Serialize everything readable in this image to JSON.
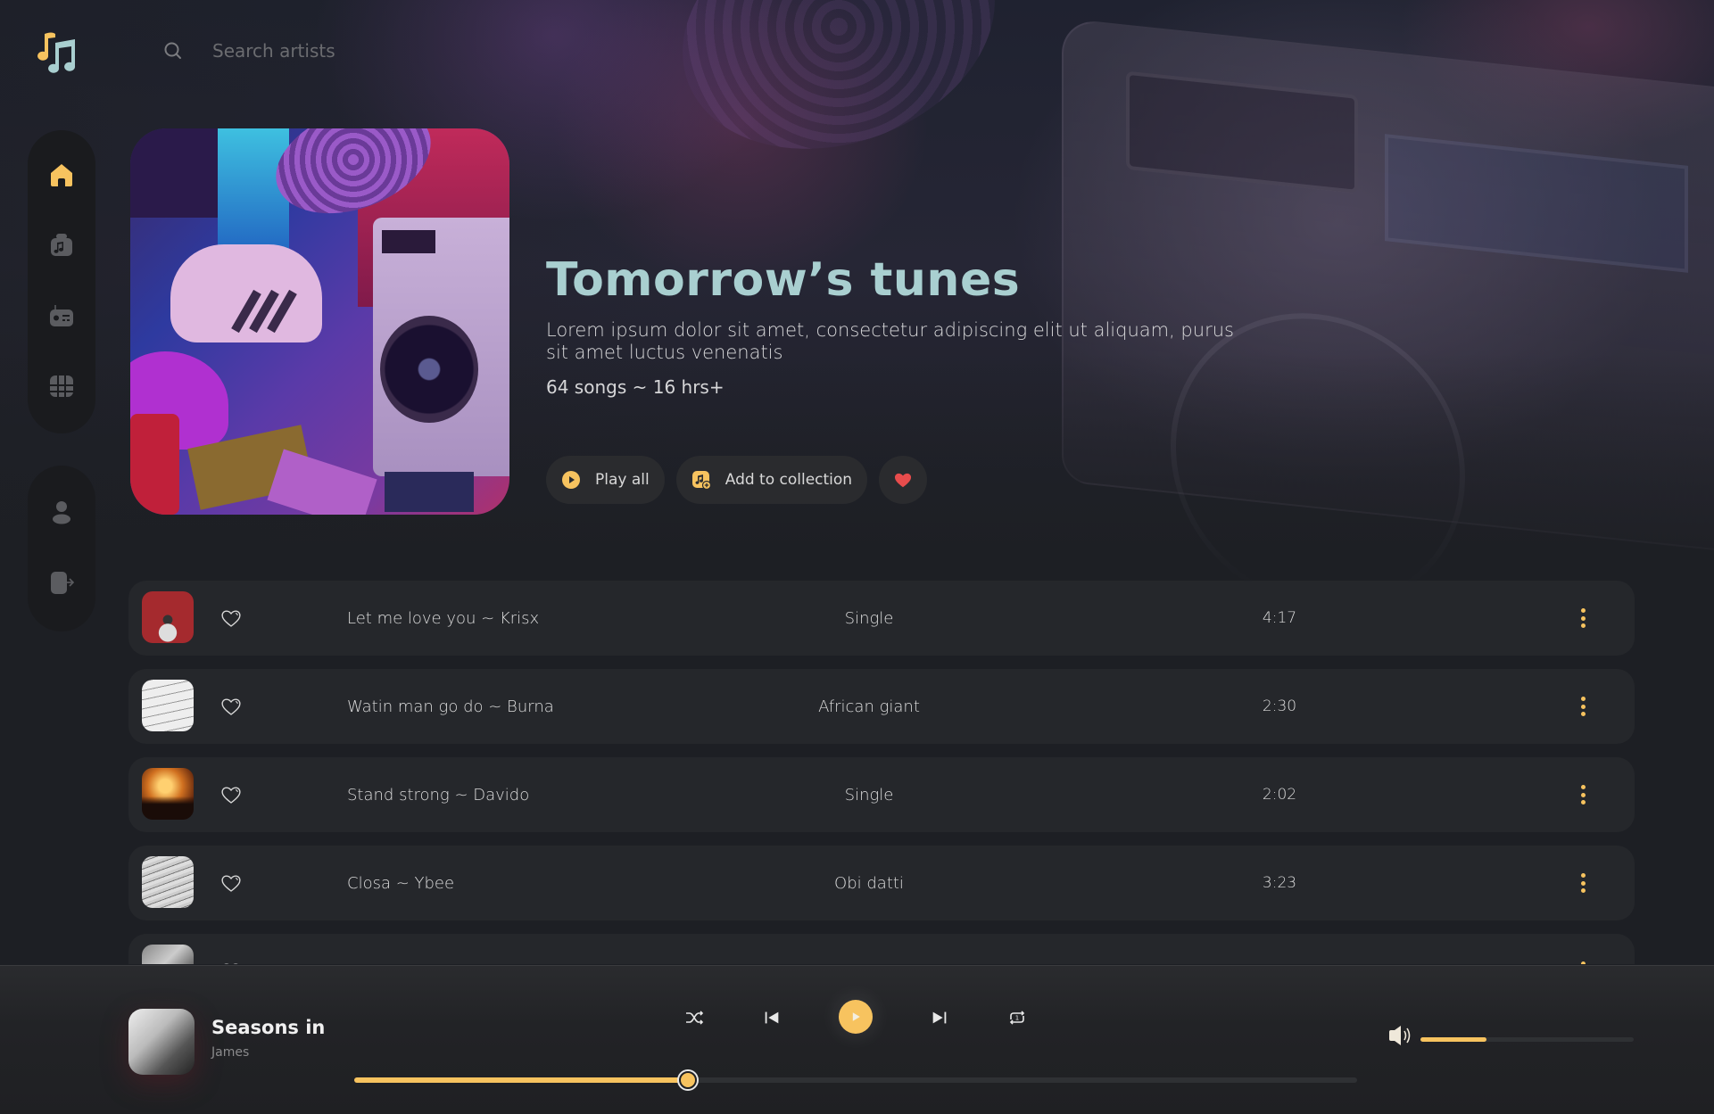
{
  "app": {
    "name": "Music player"
  },
  "search": {
    "placeholder": "Search artists",
    "value": ""
  },
  "sidebar": {
    "top_items": [
      {
        "id": "home",
        "icon": "home-icon",
        "active": true
      },
      {
        "id": "library",
        "icon": "music-library-icon",
        "active": false
      },
      {
        "id": "radio",
        "icon": "radio-icon",
        "active": false
      },
      {
        "id": "browse",
        "icon": "grid-icon",
        "active": false
      }
    ],
    "bottom_items": [
      {
        "id": "profile",
        "icon": "user-icon"
      },
      {
        "id": "logout",
        "icon": "logout-icon"
      }
    ]
  },
  "colors": {
    "accent": "#f7c35f",
    "title": "#a9cfd0",
    "heart": "#e74c4c",
    "row_bg": "#25272b"
  },
  "playlist": {
    "title": "Tomorrow’s tunes",
    "description": "Lorem ipsum dolor sit amet, consectetur adipiscing elit ut aliquam, purus sit amet luctus venenatis",
    "meta": "64 songs ~ 16 hrs+",
    "actions": {
      "play_all": "Play all",
      "add_to_collection": "Add to collection",
      "favorite_active": true
    }
  },
  "tracks": [
    {
      "title": "Let me love you ~ Krisx",
      "album": "Single",
      "duration": "4:17",
      "liked": false
    },
    {
      "title": "Watin man go do ~ Burna",
      "album": "African giant",
      "duration": "2:30",
      "liked": false
    },
    {
      "title": "Stand strong ~ Davido",
      "album": "Single",
      "duration": "2:02",
      "liked": false
    },
    {
      "title": "Closa ~ Ybee",
      "album": "Obi datti",
      "duration": "3:23",
      "liked": false
    },
    {
      "title": "",
      "album": "",
      "duration": "",
      "liked": false
    }
  ],
  "now_playing": {
    "title": "Seasons in",
    "artist": "James",
    "progress": 0.333,
    "volume": 0.31,
    "playing": false
  }
}
